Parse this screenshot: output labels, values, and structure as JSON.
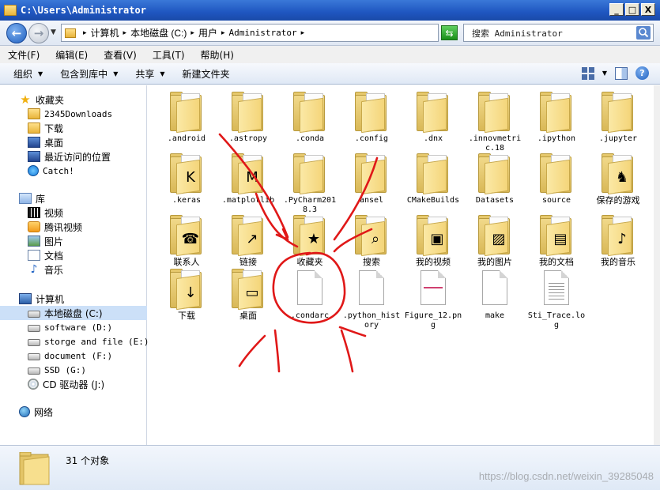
{
  "window": {
    "title": "C:\\Users\\Administrator",
    "buttons": [
      "_",
      "□",
      "X"
    ]
  },
  "address": {
    "crumbs": [
      "计算机",
      "本地磁盘 (C:)",
      "用户",
      "Administrator"
    ],
    "search_placeholder": "搜索 Administrator"
  },
  "menu": [
    "文件(F)",
    "编辑(E)",
    "查看(V)",
    "工具(T)",
    "帮助(H)"
  ],
  "toolbar": {
    "organize": "组织",
    "include": "包含到库中",
    "share": "共享",
    "new_folder": "新建文件夹"
  },
  "nav": {
    "favorites": {
      "label": "收藏夹",
      "items": [
        "2345Downloads",
        "下载",
        "桌面",
        "最近访问的位置",
        "Catch!"
      ]
    },
    "libraries": {
      "label": "库",
      "items": [
        "视频",
        "腾讯视频",
        "图片",
        "文档",
        "音乐"
      ]
    },
    "computer": {
      "label": "计算机",
      "items": [
        "本地磁盘 (C:)",
        "software (D:)",
        "storge and file (E:)",
        "document (F:)",
        "SSD (G:)",
        "CD 驱动器 (J:)"
      ]
    },
    "network": {
      "label": "网络"
    }
  },
  "items": [
    {
      "label": ".android",
      "kind": "folder"
    },
    {
      "label": ".astropy",
      "kind": "folder"
    },
    {
      "label": ".conda",
      "kind": "folder"
    },
    {
      "label": ".config",
      "kind": "folder"
    },
    {
      "label": ".dnx",
      "kind": "folder"
    },
    {
      "label": ".innovmetric.18",
      "kind": "folder"
    },
    {
      "label": ".ipython",
      "kind": "folder"
    },
    {
      "label": ".jupyter",
      "kind": "folder"
    },
    {
      "label": ".keras",
      "kind": "folder-overlay",
      "overlay": "K"
    },
    {
      "label": ".matplotlib",
      "kind": "folder-overlay",
      "overlay": "M"
    },
    {
      "label": ".PyCharm2018.3",
      "kind": "folder"
    },
    {
      "label": "ansel",
      "kind": "folder"
    },
    {
      "label": "CMakeBuilds",
      "kind": "folder"
    },
    {
      "label": "Datasets",
      "kind": "folder"
    },
    {
      "label": "source",
      "kind": "folder"
    },
    {
      "label": "保存的游戏",
      "kind": "folder-overlay",
      "overlay": "♞"
    },
    {
      "label": "联系人",
      "kind": "folder-overlay",
      "overlay": "☎"
    },
    {
      "label": "链接",
      "kind": "folder-overlay",
      "overlay": "↗"
    },
    {
      "label": "收藏夹",
      "kind": "folder-overlay",
      "overlay": "★"
    },
    {
      "label": "搜索",
      "kind": "folder-overlay",
      "overlay": "⌕"
    },
    {
      "label": "我的视频",
      "kind": "folder-overlay",
      "overlay": "▣"
    },
    {
      "label": "我的图片",
      "kind": "folder-overlay",
      "overlay": "▨"
    },
    {
      "label": "我的文档",
      "kind": "folder-overlay",
      "overlay": "▤"
    },
    {
      "label": "我的音乐",
      "kind": "folder-overlay",
      "overlay": "♪"
    },
    {
      "label": "下载",
      "kind": "folder-overlay",
      "overlay": "↓"
    },
    {
      "label": "桌面",
      "kind": "folder-overlay",
      "overlay": "▭"
    },
    {
      "label": ".condarc",
      "kind": "file"
    },
    {
      "label": ".python_history",
      "kind": "file"
    },
    {
      "label": "Figure_12.png",
      "kind": "file-figure"
    },
    {
      "label": "make",
      "kind": "file"
    },
    {
      "label": "Sti_Trace.log",
      "kind": "file-lines"
    }
  ],
  "status": {
    "count": "31 个对象"
  },
  "watermark": "https://blog.csdn.net/weixin_39285048",
  "colors": {
    "annotation": "#e01818",
    "titlebar": "#1f56c0",
    "selection": "#cce0f8"
  }
}
